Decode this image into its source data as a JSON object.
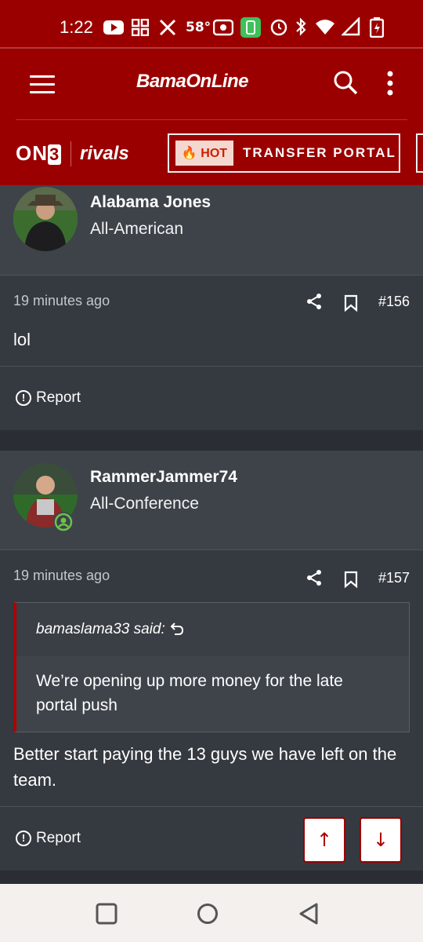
{
  "status_bar": {
    "time": "1:22",
    "temperature": "58°",
    "icons": [
      "youtube-icon",
      "apps-icon",
      "x-icon",
      "radio-icon",
      "battery-saver-icon",
      "alarm-icon",
      "bluetooth-icon",
      "wifi-icon",
      "signal-icon",
      "battery-icon"
    ]
  },
  "header": {
    "logo": "BamaOnLine",
    "brand1_on": "ON",
    "brand1_three": "3",
    "brand2": "rivals",
    "hot_badge": "HOT",
    "portal_label": "TRANSFER PORTAL"
  },
  "posts": [
    {
      "username": "Alabama Jones",
      "rank": "All-American",
      "time": "19 minutes ago",
      "number": "#156",
      "content": "lol",
      "report": "Report"
    },
    {
      "username": "RammerJammer74",
      "rank": "All-Conference",
      "time": "19 minutes ago",
      "number": "#157",
      "quote_author": "bamaslama33 said:",
      "quote_text": "We’re opening up more money for the late portal push",
      "content": "Better start paying the 13 guys we have left on the team.",
      "report": "Report"
    }
  ],
  "colors": {
    "brand_red": "#9b0000",
    "post_header_bg": "#3e434a",
    "post_body_bg": "#353940",
    "page_bg": "#2b2f35"
  }
}
